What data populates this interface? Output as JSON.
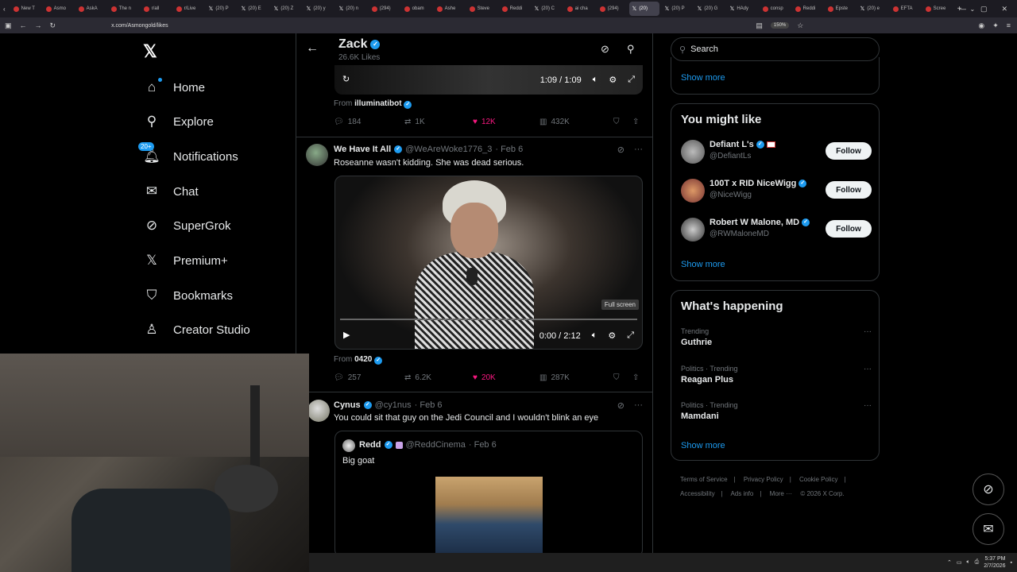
{
  "browser": {
    "tabs": [
      "New T",
      "Asmo",
      "AskA",
      "The n",
      "r/all",
      "r/Live",
      "(20) P",
      "(20) E",
      "(20) Z",
      "(20) y",
      "(20) n",
      "(294)",
      "obam",
      "Ashe",
      "Steve",
      "Reddi",
      "(20) C",
      "ai cha",
      "(294)",
      "(20)",
      "(20) P",
      "(20) G",
      "HAdy",
      "consp",
      "Reddi",
      "Epste",
      "(20) e",
      "EFTA",
      "Scree"
    ],
    "url": "x.com/Asmongold/likes",
    "zoom": "150%"
  },
  "nav": {
    "home": "Home",
    "explore": "Explore",
    "notifications": "Notifications",
    "notif_badge": "20+",
    "chat": "Chat",
    "supergrok": "SuperGrok",
    "premium": "Premium+",
    "bookmarks": "Bookmarks",
    "creator": "Creator Studio"
  },
  "profile": {
    "name": "Zack",
    "likes": "26.6K Likes"
  },
  "post0": {
    "time": "1:09 / 1:09",
    "from_label": "From",
    "from_name": "illuminatibot",
    "replies": "184",
    "reposts": "1K",
    "likes": "12K",
    "views": "432K"
  },
  "post1": {
    "name": "We Have It All",
    "handle": "@WeAreWoke1776_3",
    "date": "· Feb 6",
    "text": "Roseanne wasn't kidding.  She was dead serious.",
    "fs_tip": "Full screen",
    "time": "0:00 / 2:12",
    "from_label": "From",
    "from_name": "0420",
    "replies": "257",
    "reposts": "6.2K",
    "likes": "20K",
    "views": "287K"
  },
  "post2": {
    "name": "Cynus",
    "handle": "@cy1nus",
    "date": "· Feb 6",
    "text": "You could sit that guy on the Jedi Council and I wouldn't blink an eye",
    "quote_name": "Redd",
    "quote_handle": "@ReddCinema",
    "quote_date": "· Feb 6",
    "quote_text": "Big goat"
  },
  "right": {
    "search_placeholder": "Search",
    "show_more_top": "Show more",
    "wtf_title": "You might like",
    "follow": "Follow",
    "suggestions": [
      {
        "name": "Defiant L's",
        "handle": "@DefiantLs"
      },
      {
        "name": "100T x RID NiceWigg",
        "handle": "@NiceWigg"
      },
      {
        "name": "Robert W Malone, MD",
        "handle": "@RWMaloneMD"
      }
    ],
    "show_more_wtf": "Show more",
    "trends_title": "What's happening",
    "trends": [
      {
        "context": "Trending",
        "name": "Guthrie"
      },
      {
        "context": "Politics · Trending",
        "name": "Reagan Plus"
      },
      {
        "context": "Politics · Trending",
        "name": "Mamdani"
      }
    ],
    "show_more_trends": "Show more",
    "footer": {
      "terms": "Terms of Service",
      "privacy": "Privacy Policy",
      "cookie": "Cookie Policy",
      "accessibility": "Accessibility",
      "ads": "Ads info",
      "more": "More ···",
      "copyright": "© 2026 X Corp."
    }
  },
  "taskbar": {
    "time": "5:37 PM",
    "date": "2/7/2026"
  }
}
